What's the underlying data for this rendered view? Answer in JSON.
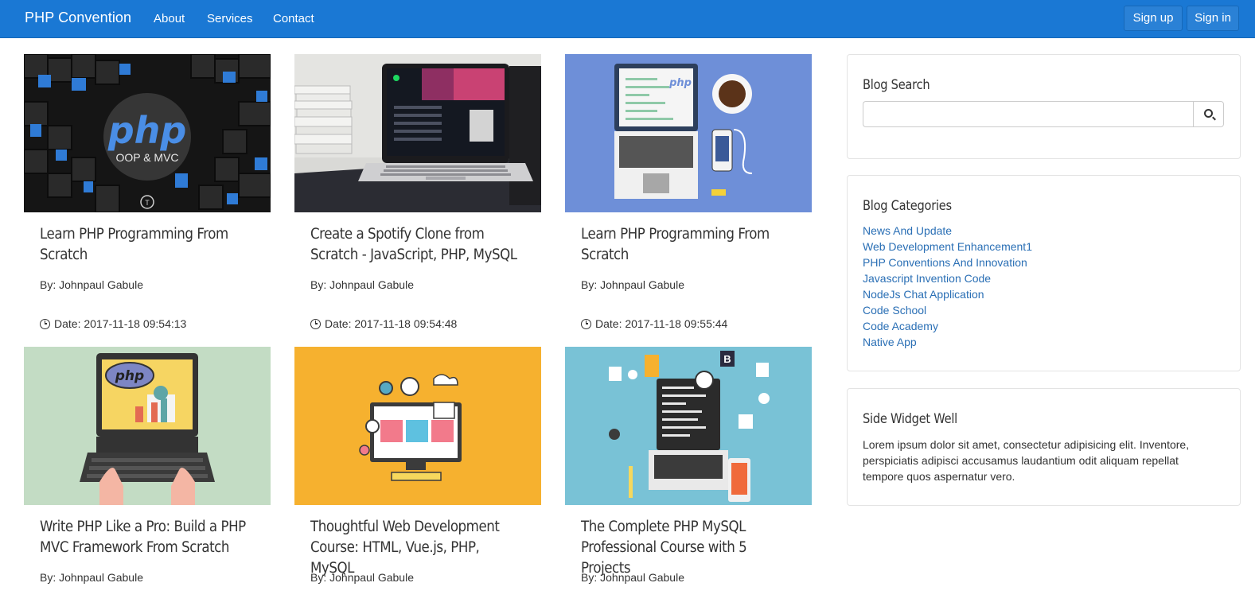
{
  "navbar": {
    "brand": "PHP Convention",
    "links": [
      "About",
      "Services",
      "Contact"
    ],
    "signup": "Sign up",
    "signin": "Sign in"
  },
  "posts": [
    {
      "title": "Learn PHP Programming From Scratch",
      "author": "By: Johnpaul Gabule",
      "date": "Date: 2017-11-18 09:54:13",
      "image": "php-oop-mvc-thumbnail"
    },
    {
      "title": "Create a Spotify Clone from Scratch - JavaScript, PHP, MySQL",
      "author": "By: Johnpaul Gabule",
      "date": "Date: 2017-11-18 09:54:48",
      "image": "laptop-music-app-thumbnail"
    },
    {
      "title": "Learn PHP Programming From Scratch",
      "author": "By: Johnpaul Gabule",
      "date": "Date: 2017-11-18 09:55:44",
      "image": "php-laptop-coffee-thumbnail"
    },
    {
      "title": "Write PHP Like a Pro: Build a PHP MVC Framework From Scratch",
      "author": "By: Johnpaul Gabule",
      "image": "php-laptop-hands-thumbnail"
    },
    {
      "title": "Thoughtful Web Development Course: HTML, Vue.js, PHP, MySQL",
      "author": "By: Johnpaul Gabule",
      "image": "web-dev-illustration-thumbnail"
    },
    {
      "title": "The Complete PHP MySQL Professional Course with 5 Projects",
      "author": "By: Johnpaul Gabule",
      "image": "php-mysql-illustration-thumbnail"
    }
  ],
  "thumb_text": {
    "php": "php",
    "oop": "OOP & MVC",
    "badge": "B"
  },
  "sidebar": {
    "search_title": "Blog Search",
    "search_value": "",
    "categories_title": "Blog Categories",
    "categories": [
      "News And Update",
      "Web Development Enhancement1",
      "PHP Conventions And Innovation",
      "Javascript Invention Code",
      "NodeJs Chat Application",
      "Code School",
      "Code Academy",
      "Native App"
    ],
    "widget_title": "Side Widget Well",
    "widget_text": "Lorem ipsum dolor sit amet, consectetur adipisicing elit. Inventore, perspiciatis adipisci accusamus laudantium odit aliquam repellat tempore quos aspernatur vero."
  },
  "colors": {
    "navbar": "#1a78d4",
    "link": "#2a6fb5",
    "thumb_green": "#c3dcc4",
    "thumb_orange": "#f6b12f",
    "thumb_blue": "#79c2d6",
    "thumb_periwinkle": "#6e8fd8"
  }
}
